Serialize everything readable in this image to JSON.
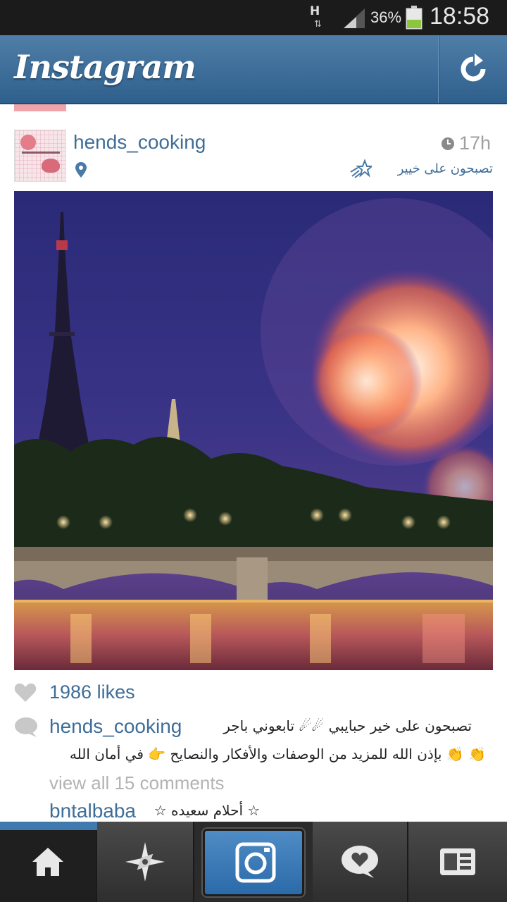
{
  "status_bar": {
    "network": "H",
    "battery_percent": "36%",
    "time": "18:58",
    "signal_icon": "signal-bars-icon",
    "battery_icon": "battery-icon"
  },
  "header": {
    "logo": "Instagram",
    "refresh_icon": "refresh-icon"
  },
  "post": {
    "username": "hends_cooking",
    "time_ago": "17h",
    "location": "تصبحون على خيير",
    "likes": "1986 likes",
    "caption_user": "hends_cooking",
    "caption_line1": "تصبحون على خير حبايبي ☄☄ تابعوني باجر",
    "caption_line2": "👏 👏 بإذن الله للمزيد من الوصفات والأفكار والنصايح 👉 في أمان الله",
    "view_comments": "view all 15 comments",
    "comments": [
      {
        "user": "bntalbaba",
        "text": "☆ أحلام سعيده ☆"
      }
    ]
  },
  "bottom_nav": {
    "items": [
      "home-icon",
      "explore-icon",
      "camera-icon",
      "news-icon",
      "profile-icon"
    ],
    "active": "home-icon"
  },
  "colors": {
    "header_blue": "#3b6b97",
    "link_blue": "#3e6d98",
    "accent_blue": "#3f79ad",
    "status_bar": "#1b1b1b"
  }
}
